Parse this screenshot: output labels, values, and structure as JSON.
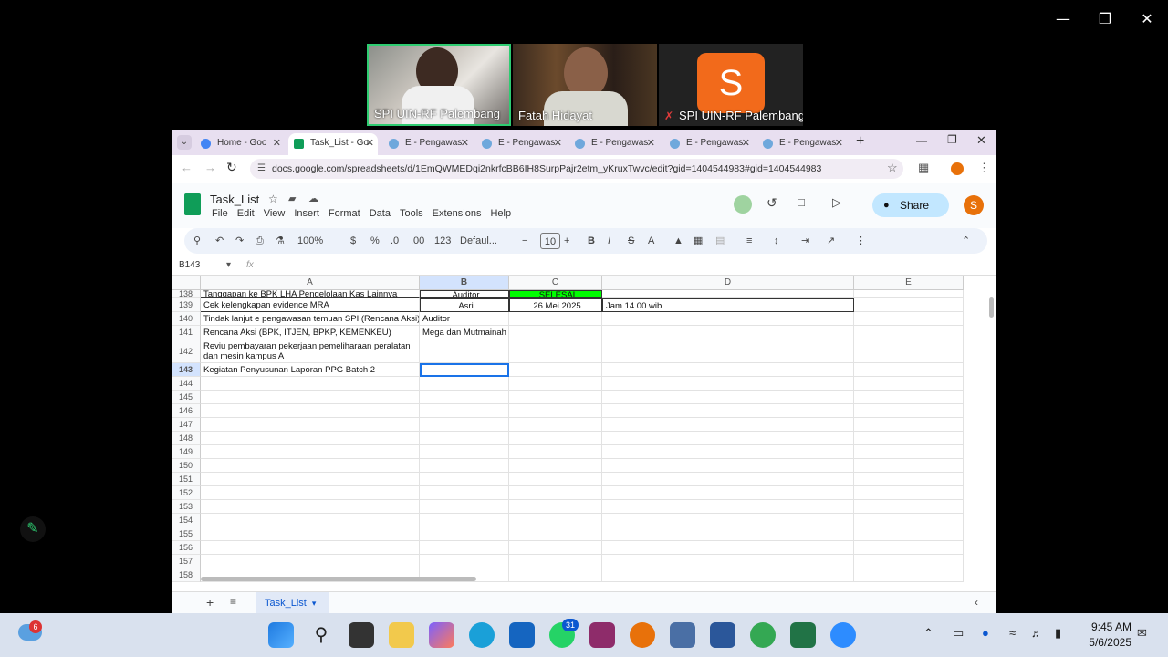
{
  "zoom": {
    "participants": [
      {
        "name": "SPI UIN-RF Palembang",
        "muted": false
      },
      {
        "name": "Fatah Hidayat",
        "muted": false
      },
      {
        "name": "SPI UIN-RF Palembang",
        "muted": true,
        "avatar_letter": "S"
      }
    ]
  },
  "browser": {
    "tabs": [
      {
        "label": "Home - Goo"
      },
      {
        "label": "Task_List - Go"
      },
      {
        "label": "E - Pengawas"
      },
      {
        "label": "E - Pengawas"
      },
      {
        "label": "E - Pengawas"
      },
      {
        "label": "E - Pengawas"
      },
      {
        "label": "E - Pengawas"
      }
    ],
    "url": "docs.google.com/spreadsheets/d/1EmQWMEDqi2nkrfcBB6IH8SurpPajr2etm_yKruxTwvc/edit?gid=1404544983#gid=1404544983"
  },
  "sheet": {
    "title": "Task_List",
    "menu": [
      "File",
      "Edit",
      "View",
      "Insert",
      "Format",
      "Data",
      "Tools",
      "Extensions",
      "Help"
    ],
    "share_label": "Share",
    "user_initial": "S",
    "zoom_level": "100%",
    "font_name": "Defaul...",
    "font_size": "10",
    "currency": "$",
    "percent": "%",
    "dec_less": ".0",
    "dec_more": ".00",
    "number_format": "123",
    "cell_ref": "B143",
    "fx": "fx",
    "columns": [
      "A",
      "B",
      "C",
      "D",
      "E"
    ],
    "rows": [
      {
        "num": "138",
        "a": "Tanggapan ke BPK LHA Pengelolaan Kas Lainnya",
        "b": "Auditor",
        "c": "SELESAI",
        "d": ""
      },
      {
        "num": "139",
        "a": "Cek kelengkapan evidence MRA",
        "b": "Asri",
        "c": "26 Mei 2025",
        "d": "Jam 14.00 wib"
      },
      {
        "num": "140",
        "a": "Tindak lanjut e pengawasan temuan SPI (Rencana Aksi)",
        "b": "Auditor",
        "c": "",
        "d": ""
      },
      {
        "num": "141",
        "a": "Rencana Aksi (BPK, ITJEN, BPKP, KEMENKEU)",
        "b": "Mega dan Mutmainah",
        "c": "",
        "d": ""
      },
      {
        "num": "142",
        "a": "Reviu pembayaran pekerjaan pemeliharaan peralatan dan mesin kampus A",
        "b": "",
        "c": "",
        "d": ""
      },
      {
        "num": "143",
        "a": "Kegiatan Penyusunan Laporan PPG Batch 2",
        "b": "",
        "c": "",
        "d": ""
      },
      {
        "num": "144"
      },
      {
        "num": "145"
      },
      {
        "num": "146"
      },
      {
        "num": "147"
      },
      {
        "num": "148"
      },
      {
        "num": "149"
      },
      {
        "num": "150"
      },
      {
        "num": "151"
      },
      {
        "num": "152"
      },
      {
        "num": "153"
      },
      {
        "num": "154"
      },
      {
        "num": "155"
      },
      {
        "num": "156"
      },
      {
        "num": "157"
      },
      {
        "num": "158"
      }
    ],
    "sheet_tab": "Task_List"
  },
  "taskbar": {
    "time": "9:45 AM",
    "date": "5/6/2025",
    "weather_badge": "6",
    "whatsapp_badge": "31"
  },
  "colors": {
    "selesai_green": "#00ff00",
    "selection_blue": "#1a73e8",
    "share_bg": "#c2e7ff",
    "sheets_green": "#0f9d58"
  }
}
